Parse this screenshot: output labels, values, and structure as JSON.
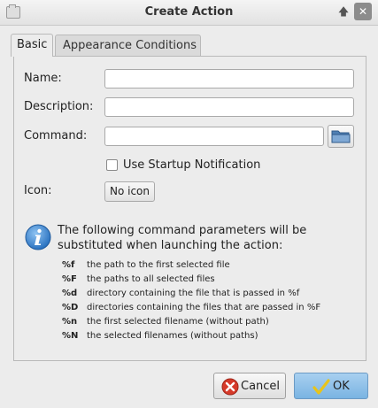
{
  "window": {
    "title": "Create Action",
    "buttons": {
      "up_icon": "up-arrow-icon",
      "close_icon": "close-icon",
      "up_glyph": "🡅",
      "close_glyph": "✕"
    }
  },
  "tabs": [
    {
      "label": "Basic",
      "selected": true
    },
    {
      "label": "Appearance Conditions",
      "selected": false
    }
  ],
  "form": {
    "name": {
      "label": "Name:",
      "value": ""
    },
    "description": {
      "label": "Description:",
      "value": ""
    },
    "command": {
      "label": "Command:",
      "value": "",
      "browse_icon": "folder-icon"
    },
    "startup_notification": {
      "label": "Use Startup Notification",
      "checked": false
    },
    "icon": {
      "label": "Icon:",
      "button_label": "No icon"
    }
  },
  "info": {
    "icon": "info-icon",
    "text": "The following command parameters will be substituted when launching the action:",
    "params": [
      {
        "code": "%f",
        "description": "the path to the first selected file"
      },
      {
        "code": "%F",
        "description": "the paths to all selected files"
      },
      {
        "code": "%d",
        "description": "directory containing the file that is passed in %f"
      },
      {
        "code": "%D",
        "description": "directories containing the files that are passed in %F"
      },
      {
        "code": "%n",
        "description": "the first selected filename (without path)"
      },
      {
        "code": "%N",
        "description": "the selected filenames (without paths)"
      }
    ]
  },
  "footer": {
    "cancel": {
      "label": "Cancel",
      "icon": "cancel-icon"
    },
    "ok": {
      "label": "OK",
      "icon": "checkmark-icon"
    }
  },
  "colors": {
    "ok_button": "#7ab4e2",
    "info_icon": "#3c8bd8",
    "cancel_icon": "#d63a2a",
    "check_icon": "#f0d020"
  }
}
